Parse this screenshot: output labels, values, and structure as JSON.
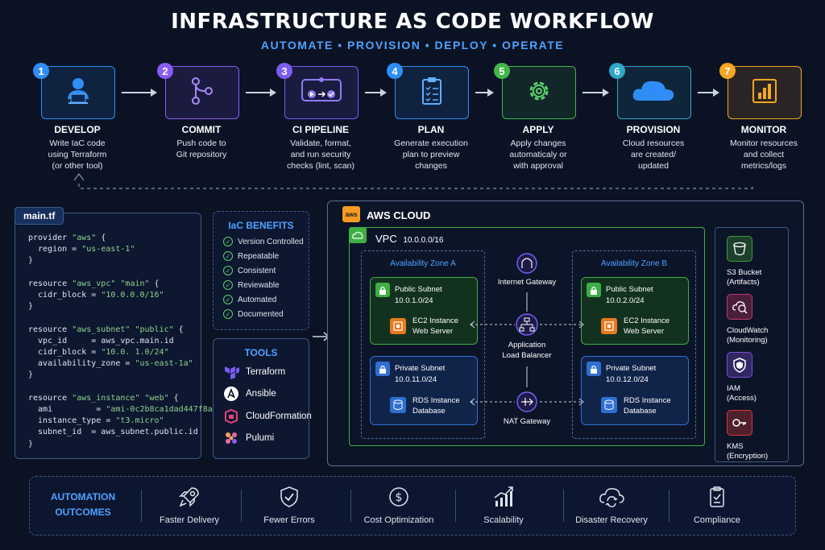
{
  "header": {
    "title": "INFRASTRUCTURE AS CODE WORKFLOW",
    "subtitle": "AUTOMATE • PROVISION • DEPLOY • OPERATE"
  },
  "steps": [
    {
      "num": "1",
      "name": "DEVELOP",
      "desc": [
        "Write IaC code",
        "using Terraform",
        "(or other tool)"
      ],
      "color": "#2f8ef5",
      "icon": "developer-laptop-icon"
    },
    {
      "num": "2",
      "name": "COMMIT",
      "desc": [
        "Push code to",
        "Git repository"
      ],
      "color": "#8a5cf6",
      "icon": "git-branch-icon"
    },
    {
      "num": "3",
      "name": "CI PIPELINE",
      "desc": [
        "Validate, format,",
        "and run security",
        "checks (lint, scan)"
      ],
      "color": "#7a5cf0",
      "icon": "pipeline-icon"
    },
    {
      "num": "4",
      "name": "PLAN",
      "desc": [
        "Generate execution",
        "plan to preview",
        "changes"
      ],
      "color": "#2f8ef5",
      "icon": "clipboard-checklist-icon"
    },
    {
      "num": "5",
      "name": "APPLY",
      "desc": [
        "Apply changes",
        "automaticaly or",
        "with approval"
      ],
      "color": "#43b649",
      "icon": "gear-icon"
    },
    {
      "num": "6",
      "name": "PROVISION",
      "desc": [
        "Cloud resources",
        "are created/",
        "updated"
      ],
      "color": "#2fa8c9",
      "icon": "cloud-icon"
    },
    {
      "num": "7",
      "name": "MONITOR",
      "desc": [
        "Monitor resources",
        "and collect",
        "metrics/logs"
      ],
      "color": "#f5a623",
      "icon": "bar-chart-icon"
    }
  ],
  "code": {
    "filename": "main.tf",
    "lines": [
      "provider \"aws\" {",
      "  region = \"us-east-1\"",
      "}",
      "",
      "resource \"aws_vpc\" \"main\" {",
      "  cidr_block = \"10.0.0.0/16\"",
      "}",
      "",
      "resource \"aws_subnet\" \"public\" {",
      "  vpc_id     = aws_vpc.main.id",
      "  cidr_block = \"10.0. 1.0/24\"",
      "  availability_zone = \"us-east-1a\"",
      "}",
      "",
      "resource \"aws_instance\" \"web\" {",
      "  ami         = \"ami-0c2b8ca1dad447f8a\"",
      "  instance_type = \"t3.micro\"",
      "  subnet_id  = aws_subnet.public.id",
      "}"
    ]
  },
  "benefits": {
    "title": "IaC BENEFITS",
    "items": [
      "Version Controlled",
      "Repeatable",
      "Consistent",
      "Reviewable",
      "Automated",
      "Documented"
    ]
  },
  "tools": {
    "title": "TOOLS",
    "items": [
      {
        "name": "Terraform",
        "icon": "terraform-icon",
        "color": "#7b5cf0"
      },
      {
        "name": "Ansible",
        "icon": "ansible-icon",
        "color": "#ffffff"
      },
      {
        "name": "CloudFormation",
        "icon": "cloudformation-icon",
        "color": "#e0457b"
      },
      {
        "name": "Pulumi",
        "icon": "pulumi-icon",
        "color": "#f4a261"
      }
    ]
  },
  "aws": {
    "label": "AWS CLOUD",
    "logo": "aws",
    "vpc_label": "VPC",
    "vpc_cidr": "10.0.0.0/16",
    "az_a": "Availability Zone A",
    "az_b": "Availability Zone B",
    "public_a": {
      "title": "Public Subnet",
      "cidr": "10.0.1.0/24",
      "res1": "EC2 Instance",
      "res2": "Web Server"
    },
    "private_a": {
      "title": "Private Subnet",
      "cidr": "10.0.11.0/24",
      "res1": "RDS Instance",
      "res2": "Database"
    },
    "public_b": {
      "title": "Public Subnet",
      "cidr": "10.0.2.0/24",
      "res1": "EC2 Instance",
      "res2": "Web Server"
    },
    "private_b": {
      "title": "Private Subnet",
      "cidr": "10.0.12.0/24",
      "res1": "RDS Instance",
      "res2": "Database"
    },
    "igw": "Internet Gateway",
    "alb1": "Application",
    "alb2": "Load Balancer",
    "nat": "NAT Gateway",
    "services": [
      {
        "l1": "S3 Bucket",
        "l2": "(Artifacts)",
        "color": "#3f9a3a",
        "icon": "bucket-icon"
      },
      {
        "l1": "CloudWatch",
        "l2": "(Monitoring)",
        "color": "#c2376a",
        "icon": "cloudwatch-icon"
      },
      {
        "l1": "IAM",
        "l2": "(Access)",
        "color": "#7a4fd6",
        "icon": "shield-icon"
      },
      {
        "l1": "KMS",
        "l2": "(Encryption)",
        "color": "#d9383a",
        "icon": "key-icon"
      }
    ]
  },
  "outcomes": {
    "title1": "AUTOMATION",
    "title2": "OUTCOMES",
    "items": [
      {
        "label": "Faster Delivery",
        "icon": "rocket-icon"
      },
      {
        "label": "Fewer Errors",
        "icon": "shield-check-icon"
      },
      {
        "label": "Cost Optimization",
        "icon": "dollar-icon"
      },
      {
        "label": "Scalability",
        "icon": "growth-chart-icon"
      },
      {
        "label": "Disaster Recovery",
        "icon": "cloud-refresh-icon"
      },
      {
        "label": "Compliance",
        "icon": "clipboard-check-icon"
      }
    ]
  }
}
